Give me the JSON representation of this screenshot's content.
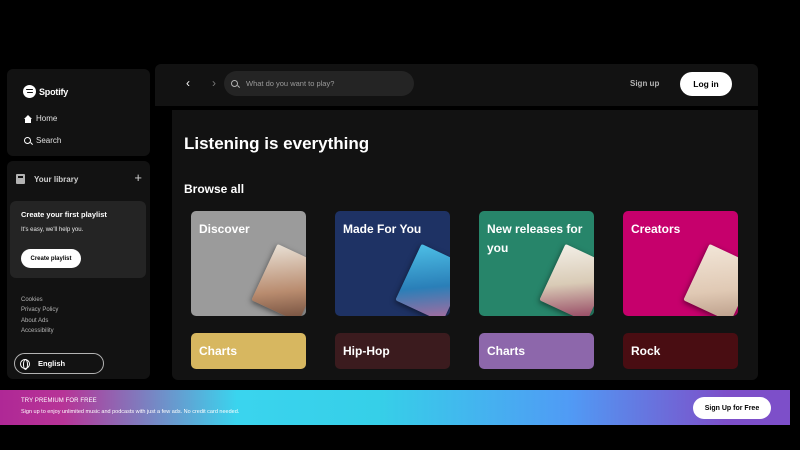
{
  "brand": {
    "name": "Spotify"
  },
  "nav": {
    "home": "Home",
    "search": "Search"
  },
  "library": {
    "title": "Your library",
    "add_symbol": "+",
    "card": {
      "title": "Create your first playlist",
      "subtitle": "It's easy, we'll help you.",
      "button": "Create playlist"
    },
    "legal": [
      "Cookies",
      "Privacy Policy",
      "About Ads",
      "Accessibility"
    ],
    "language": "English"
  },
  "header": {
    "back_symbol": "‹",
    "forward_symbol": "›",
    "search_placeholder": "What do you want to play?",
    "signup": "Sign up",
    "login": "Log in"
  },
  "main": {
    "heading": "Listening is everything",
    "browse_title": "Browse all",
    "tiles": [
      {
        "label": "Discover",
        "color": "#9b9b9b"
      },
      {
        "label": "Made For You",
        "color": "#1e3264"
      },
      {
        "label": "New releases for you",
        "color": "#27856a"
      },
      {
        "label": "Creators",
        "color": "#c6006c"
      },
      {
        "label": "Charts",
        "color": "#d7b760"
      },
      {
        "label": "Hip-Hop",
        "color": "#3b1b1e"
      },
      {
        "label": "Charts",
        "color": "#8d67ab"
      },
      {
        "label": "Rock",
        "color": "#490d12"
      }
    ]
  },
  "banner": {
    "title": "TRY PREMIUM FOR FREE",
    "subtitle": "Sign up to enjoy unlimited music and podcasts with just a few ads. No credit card needed.",
    "button": "Sign Up for Free"
  }
}
